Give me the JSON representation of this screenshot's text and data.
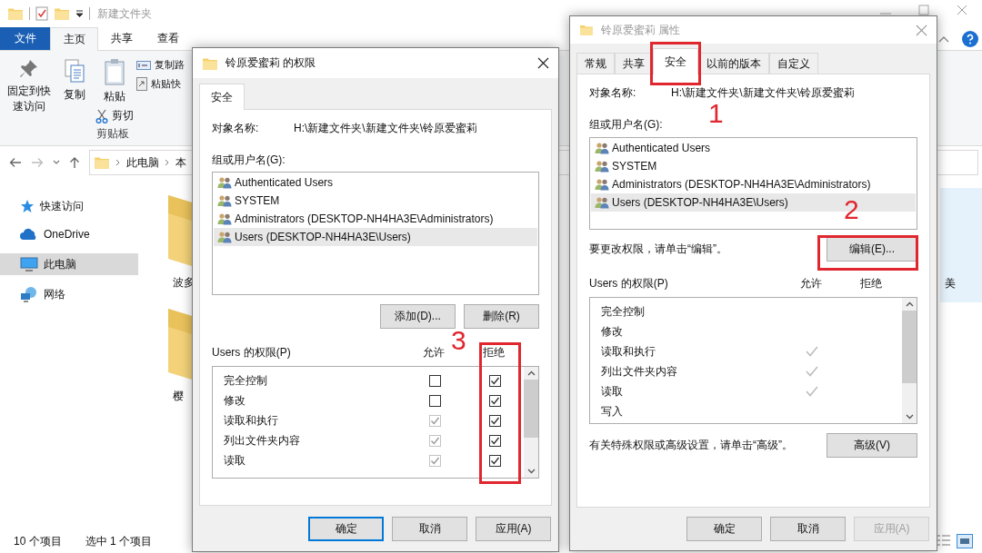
{
  "explorer": {
    "title": "新建文件夹",
    "ribbon_tabs": [
      {
        "label": "文件",
        "kind": "file",
        "selected": false
      },
      {
        "label": "主页",
        "kind": "tab",
        "selected": true
      },
      {
        "label": "共享",
        "kind": "tab",
        "selected": false
      },
      {
        "label": "查看",
        "kind": "tab",
        "selected": false
      }
    ],
    "ribbon": {
      "pin": "固定到快速访问",
      "copy": "复制",
      "paste": "粘贴",
      "cut": "剪切",
      "copy_path": "复制路",
      "paste_shortcut": "粘贴快",
      "group_label": "剪贴板"
    },
    "address": [
      "此电脑",
      "本"
    ],
    "nav": [
      {
        "label": "快速访问",
        "kind": "star",
        "selected": false
      },
      {
        "label": "OneDrive",
        "kind": "cloud",
        "selected": false
      },
      {
        "label": "此电脑",
        "kind": "pc",
        "selected": true
      },
      {
        "label": "网络",
        "kind": "network",
        "selected": false
      }
    ],
    "items": [
      {
        "label": "波多",
        "selected": false
      },
      {
        "label": "樱",
        "selected": false
      }
    ],
    "side_item": {
      "label": "美",
      "selected": true
    },
    "status": [
      "10 个项目",
      "选中 1 个项目"
    ]
  },
  "permissions_dialog": {
    "title": "铃原爱蜜莉 的权限",
    "active": true,
    "tabs": [
      {
        "label": "安全",
        "selected": true
      }
    ],
    "object_label": "对象名称:",
    "object_path": "H:\\新建文件夹\\新建文件夹\\铃原爱蜜莉",
    "group_label": "组或用户名(G):",
    "users": [
      {
        "name": "Authenticated Users",
        "selected": false
      },
      {
        "name": "SYSTEM",
        "selected": false
      },
      {
        "name": "Administrators (DESKTOP-NH4HA3E\\Administrators)",
        "selected": false
      },
      {
        "name": "Users (DESKTOP-NH4HA3E\\Users)",
        "selected": true
      }
    ],
    "user_buttons": [
      "添加(D)...",
      "删除(R)"
    ],
    "perm_label": "Users 的权限(P)",
    "allow_label": "允许",
    "deny_label": "拒绝",
    "deny_annotated": true,
    "permissions": [
      {
        "name": "完全控制",
        "allow": {
          "checked": false,
          "disabled": false
        },
        "deny": {
          "checked": true,
          "disabled": false
        }
      },
      {
        "name": "修改",
        "allow": {
          "checked": false,
          "disabled": false
        },
        "deny": {
          "checked": true,
          "disabled": false
        }
      },
      {
        "name": "读取和执行",
        "allow": {
          "checked": true,
          "disabled": true
        },
        "deny": {
          "checked": true,
          "disabled": false
        }
      },
      {
        "name": "列出文件夹内容",
        "allow": {
          "checked": true,
          "disabled": true
        },
        "deny": {
          "checked": true,
          "disabled": false
        }
      },
      {
        "name": "读取",
        "allow": {
          "checked": true,
          "disabled": true
        },
        "deny": {
          "checked": true,
          "disabled": false
        }
      }
    ],
    "buttons": [
      {
        "label": "确定",
        "default": true,
        "disabled": false
      },
      {
        "label": "取消",
        "default": false,
        "disabled": false
      },
      {
        "label": "应用(A)",
        "default": false,
        "disabled": false
      }
    ]
  },
  "properties_dialog": {
    "title": "铃原爱蜜莉 属性",
    "active": false,
    "tabs": [
      {
        "label": "常规",
        "selected": false,
        "annotated": false
      },
      {
        "label": "共享",
        "selected": false,
        "annotated": false
      },
      {
        "label": "安全",
        "selected": true,
        "annotated": true
      },
      {
        "label": "以前的版本",
        "selected": false,
        "annotated": false
      },
      {
        "label": "自定义",
        "selected": false,
        "annotated": false
      }
    ],
    "object_label": "对象名称:",
    "object_path": "H:\\新建文件夹\\新建文件夹\\铃原爱蜜莉",
    "group_label": "组或用户名(G):",
    "users": [
      {
        "name": "Authenticated Users",
        "selected": false
      },
      {
        "name": "SYSTEM",
        "selected": false
      },
      {
        "name": "Administrators (DESKTOP-NH4HA3E\\Administrators)",
        "selected": false
      },
      {
        "name": "Users (DESKTOP-NH4HA3E\\Users)",
        "selected": true
      }
    ],
    "edit_note": "要更改权限，请单击“编辑”。",
    "edit_button": {
      "label": "编辑(E)...",
      "annotated": true
    },
    "perm_label": "Users 的权限(P)",
    "allow_label": "允许",
    "deny_label": "拒绝",
    "permissions": [
      {
        "name": "完全控制",
        "allow": false,
        "deny": false
      },
      {
        "name": "修改",
        "allow": false,
        "deny": false
      },
      {
        "name": "读取和执行",
        "allow": true,
        "deny": false
      },
      {
        "name": "列出文件夹内容",
        "allow": true,
        "deny": false
      },
      {
        "name": "读取",
        "allow": true,
        "deny": false
      },
      {
        "name": "写入",
        "allow": false,
        "deny": false
      }
    ],
    "advanced_note": "有关特殊权限或高级设置，请单击“高级”。",
    "advanced_button": "高级(V)",
    "buttons": [
      {
        "label": "确定",
        "default": false,
        "disabled": false
      },
      {
        "label": "取消",
        "default": false,
        "disabled": false
      },
      {
        "label": "应用(A)",
        "default": false,
        "disabled": true
      }
    ]
  },
  "callouts": [
    "1",
    "2",
    "3"
  ]
}
